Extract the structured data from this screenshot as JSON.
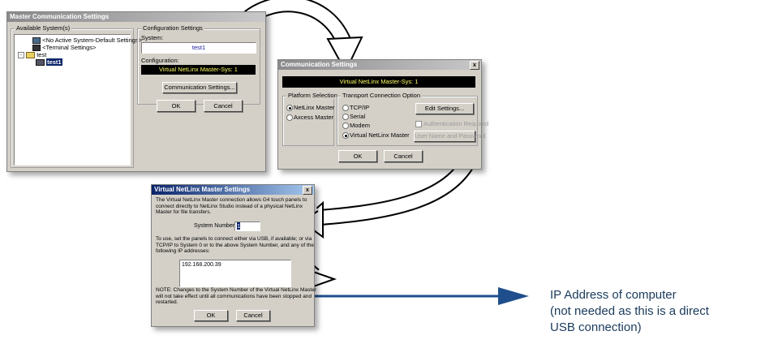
{
  "master_window": {
    "title": "Master Communication Settings",
    "available_label": "Available System(s)",
    "tree_items": [
      "<No Active System-Default Settings>",
      "<Terminal Settings>",
      "test",
      "test1"
    ],
    "config_group_label": "Configuration Settings",
    "system_label": "System:",
    "system_value": "test1",
    "configuration_label": "Configuration:",
    "configuration_value": "Virtual NetLinx Master-Sys: 1",
    "comm_settings_button": "Communication Settings...",
    "ok_button": "OK",
    "cancel_button": "Cancel"
  },
  "comm_window": {
    "title": "Communication Settings",
    "display_value": "Virtual NetLinx Master-Sys: 1",
    "platform_label": "Platform Selection",
    "platform_options": [
      "NetLinx Master",
      "Axcess Master"
    ],
    "transport_label": "Transport Connection Option",
    "transport_options": [
      "TCP/IP",
      "Serial",
      "Modem",
      "Virtual NetLinx Master"
    ],
    "edit_settings_button": "Edit Settings...",
    "auth_required_label": "Authentication Required",
    "user_pass_button": "User Name and Password",
    "ok_button": "OK",
    "cancel_button": "Cancel"
  },
  "vnm_window": {
    "title": "Virtual NetLinx Master Settings",
    "intro_lines": [
      "The Virtual NetLinx Master connection allows G4 touch panels to",
      "connect directly to NetLinx Studio instead of a physical NetLinx",
      "Master for file transfers."
    ],
    "system_number_label": "System Number:",
    "system_number_value": "1",
    "usage_lines": [
      "To use, set the panels to connect either via USB, if available; or via",
      "TCP/IP to System 0 or to the above System Number, and any of the",
      "following IP addresses:"
    ],
    "ip_address": "192.168.200.39",
    "note_lines": [
      "NOTE: Changes to the System Number of the Virtual NetLinx Master",
      "will not take effect until all communications have been stopped and",
      "restarted."
    ],
    "ok_button": "OK",
    "cancel_button": "Cancel"
  },
  "annotation": {
    "lines": [
      "IP Address of computer",
      "(not needed as this is a direct",
      "USB connection)"
    ]
  },
  "colors": {
    "annotation_text": "#1a3a5c",
    "pointer_arrow": "#1f4e8c",
    "display_bg": "#000000",
    "display_text": "#ffff66"
  }
}
